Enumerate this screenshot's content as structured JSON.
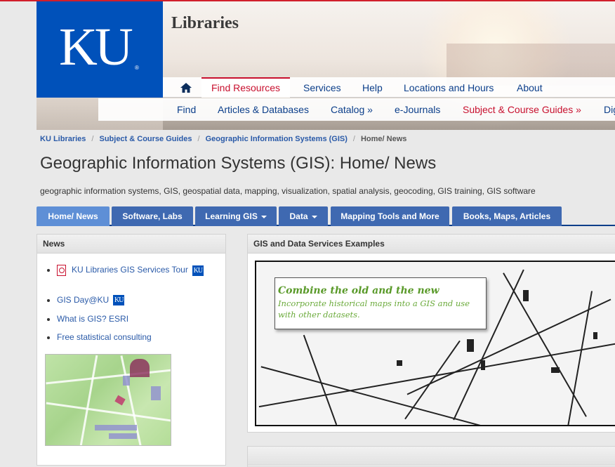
{
  "header": {
    "logo_text": "KU",
    "logo_mark": "®",
    "site_title": "Libraries",
    "primary_nav": [
      "Find Resources",
      "Services",
      "Help",
      "Locations and Hours",
      "About"
    ],
    "secondary_nav": [
      "Find",
      "Articles & Databases",
      "Catalog »",
      "e-Journals",
      "Subject & Course Guides »",
      "Dig"
    ]
  },
  "breadcrumb": [
    "KU Libraries",
    "Subject & Course Guides",
    "Geographic Information Systems (GIS)",
    "Home/ News"
  ],
  "page": {
    "title": "Geographic Information Systems (GIS): Home/ News",
    "description": "geographic information systems, GIS, geospatial data, mapping, visualization, spatial analysis, geocoding, GIS training, GIS software"
  },
  "tabs": [
    "Home/ News",
    "Software, Labs",
    "Learning GIS",
    "Data",
    "Mapping Tools and More",
    "Books, Maps, Articles"
  ],
  "news": {
    "heading": "News",
    "items": [
      "KU Libraries GIS Services Tour",
      "GIS Day@KU",
      "What is GIS? ESRI",
      "Free statistical consulting"
    ],
    "ku_badge": "KU"
  },
  "gis_examples": {
    "heading": "GIS and Data Services Examples",
    "callout_title": "Combine the old and the new",
    "callout_body": "Incorporate historical maps into a GIS and use with other datasets."
  },
  "colors": {
    "ku_blue": "#0051ba",
    "accent_red": "#c8102e",
    "link_blue": "#0b3e8a",
    "tab_blue": "#3f69b1"
  },
  "icons": [
    "home-icon",
    "pdf-icon",
    "caret-down-icon"
  ]
}
